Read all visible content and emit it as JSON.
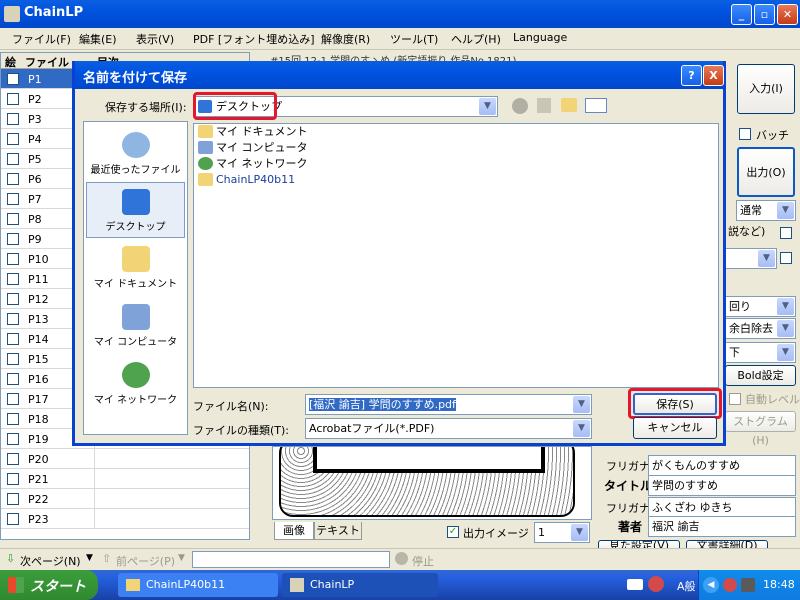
{
  "app": {
    "title": "ChainLP"
  },
  "menu": [
    "ファイル(F)",
    "編集(E)",
    "表示(V)",
    "PDF [フォント埋め込み]",
    "解像度(R)",
    "ツール(T)",
    "ヘルプ(H)",
    "Language"
  ],
  "pagelist": {
    "headers": [
      "絵",
      "ファイル",
      "目次"
    ],
    "rows": [
      "P1",
      "P2",
      "P3",
      "P4",
      "P5",
      "P6",
      "P7",
      "P8",
      "P9",
      "P10",
      "P11",
      "P12",
      "P13",
      "P14",
      "P15",
      "P16",
      "P17",
      "P18",
      "P19",
      "P20",
      "P21",
      "P22",
      "P23"
    ]
  },
  "right": {
    "top_text": "#15回 12-1 学問のすゝめ (新定語振り 作品No.1821) ...",
    "input_btn": "入力(I)",
    "batch_label": "バッチ",
    "output_btn": "出力(O)",
    "combo_normal": "通常",
    "combo_setsu": "説など)",
    "combo_kaiten": "回り",
    "combo_yohaku": "余白除去",
    "combo_ka": "下",
    "bold_btn": "Bold設定",
    "auto_level": "自動レベル",
    "histogram": "ストグラム(H)",
    "furigana1_label": "フリガナ",
    "furigana1_value": "がくもんのすすめ",
    "title_label": "タイトル",
    "title_value": "学問のすすめ",
    "furigana2_label": "フリガナ",
    "furigana2_value": "ふくざわ ゆきち",
    "author_label": "著者",
    "author_value": "福沢 諭吉",
    "bottom_btn1": "見た設定(V)",
    "bottom_btn2": "文書詳細(D)"
  },
  "preview": {
    "tab_image": "画像",
    "tab_text": "テキスト",
    "output_image_label": "出力イメージ",
    "output_image_value": "1"
  },
  "statusbar": {
    "next_page": "次ページ(N)",
    "prev_page": "前ページ(P)",
    "stop": "停止"
  },
  "dialog": {
    "title": "名前を付けて保存",
    "save_in_label": "保存する場所(I):",
    "save_in_value": "デスクトップ",
    "places": [
      "最近使ったファイル",
      "デスクトップ",
      "マイ ドキュメント",
      "マイ コンピュータ",
      "マイ ネットワーク"
    ],
    "files": [
      "マイ ドキュメント",
      "マイ コンピュータ",
      "マイ ネットワーク",
      "ChainLP40b11"
    ],
    "filename_label": "ファイル名(N):",
    "filename_value": "[福沢 諭吉] 学問のすすめ.pdf",
    "filetype_label": "ファイルの種類(T):",
    "filetype_value": "Acrobatファイル(*.PDF)",
    "save_btn": "保存(S)",
    "cancel_btn": "キャンセル",
    "help_btn": "?",
    "close_btn": "X"
  },
  "taskbar": {
    "start": "スタート",
    "tasks": [
      "ChainLP40b11",
      "ChainLP"
    ],
    "tray_time": "18:48",
    "tray_text": "A般"
  }
}
